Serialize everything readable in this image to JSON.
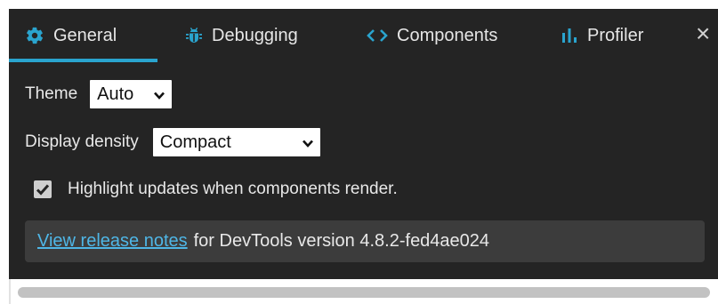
{
  "tabs": [
    {
      "id": "general",
      "label": "General",
      "icon": "gear-icon",
      "active": true
    },
    {
      "id": "debugging",
      "label": "Debugging",
      "icon": "bug-icon",
      "active": false
    },
    {
      "id": "components",
      "label": "Components",
      "icon": "code-brackets-icon",
      "active": false
    },
    {
      "id": "profiler",
      "label": "Profiler",
      "icon": "bar-chart-icon",
      "active": false
    }
  ],
  "close_label": "×",
  "theme": {
    "label": "Theme",
    "value": "Auto"
  },
  "density": {
    "label": "Display density",
    "value": "Compact"
  },
  "highlight": {
    "label": "Highlight updates when components render.",
    "checked": true
  },
  "release": {
    "link_text": "View release notes",
    "suffix": "for DevTools version 4.8.2-fed4ae024"
  },
  "colors": {
    "panel_bg": "#242424",
    "accent": "#2aa4ce",
    "link": "#4fb6e6",
    "release_bg": "#3c3c3c"
  }
}
